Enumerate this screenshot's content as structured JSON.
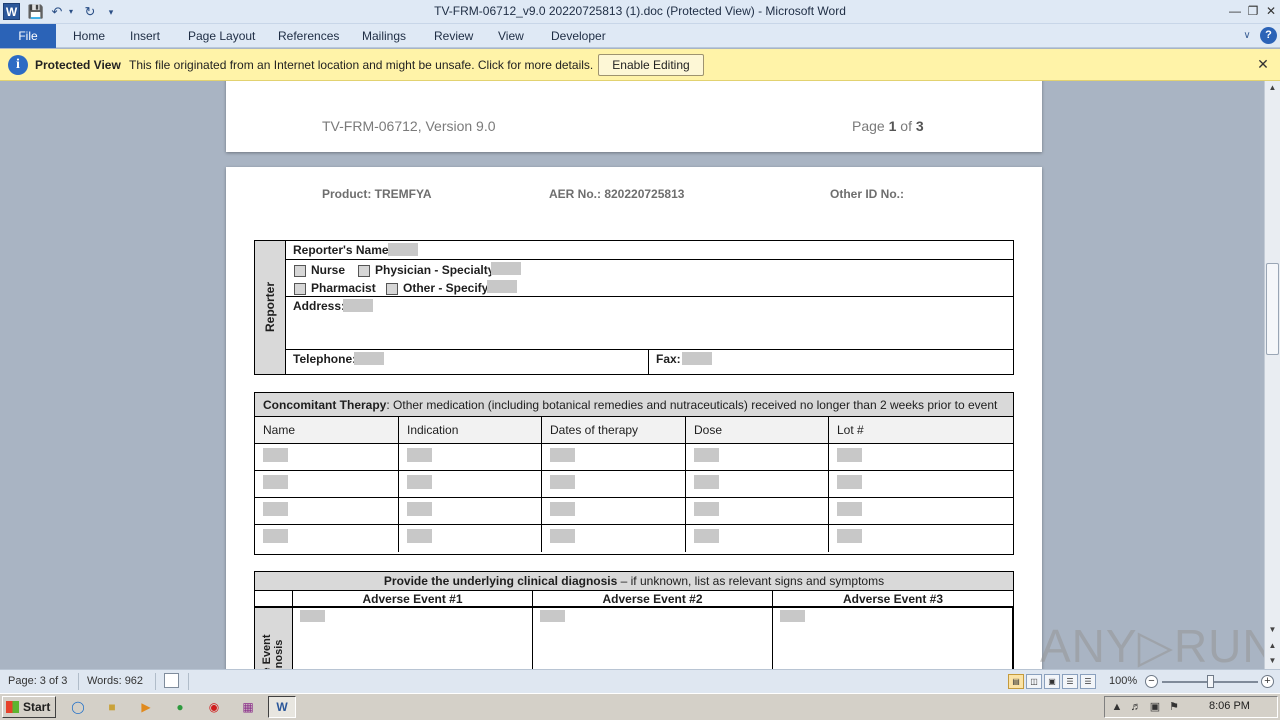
{
  "window": {
    "title": "TV-FRM-06712_v9.0 20220725813 (1).doc (Protected View)  -  Microsoft Word",
    "app_icon": "W"
  },
  "ribbon": {
    "file_tab": "File",
    "tabs": [
      "Home",
      "Insert",
      "Page Layout",
      "References",
      "Mailings",
      "Review",
      "View",
      "Developer"
    ]
  },
  "protected_view": {
    "title": "Protected View",
    "message": "This file originated from an Internet location and might be unsafe. Click for more details.",
    "button": "Enable Editing"
  },
  "page1": {
    "header_left": "TV-FRM-06712,  Version 9.0",
    "page_word": "Page ",
    "page_num": "1",
    "page_of": " of ",
    "page_total": "3"
  },
  "page2": {
    "product": "Product: TREMFYA",
    "aer": "AER No.: 820220725813",
    "other_id": "Other ID No.:",
    "reporter": {
      "side_label": "Reporter",
      "name_label": "Reporter's Name:",
      "nurse": "Nurse",
      "physician": "Physician - Specialty:",
      "pharmacist": "Pharmacist",
      "other": "Other - Specify:",
      "address": "Address:",
      "telephone": "Telephone:",
      "fax": "Fax:"
    },
    "concomitant": {
      "title": "Concomitant Therapy",
      "subtitle": ": Other medication  (including botanical  remedies and nutraceuticals)  received no longer than 2 weeks prior to event",
      "columns": [
        "Name",
        "Indication",
        "Dates  of therapy",
        "Dose",
        "Lot #"
      ]
    },
    "diagnosis": {
      "title": "Provide the underlying clinical diagnosis",
      "subtitle": " – if unknown, list  as relevant signs  and symptoms",
      "events": [
        "Adverse  Event #1",
        "Adverse  Event #2",
        "Adverse  Event #3"
      ],
      "side_label_1": "e Event",
      "side_label_2": "nosis"
    }
  },
  "watermark": "ANY▷RUN",
  "status": {
    "page": "Page: 3 of 3",
    "words": "Words: 962",
    "zoom": "100%"
  },
  "taskbar": {
    "start": "Start",
    "clock": "8:06 PM"
  },
  "colors": {
    "file_tab": "#2b63b7",
    "protected_bar": "#fff3a8",
    "doc_background": "#a9b4c3"
  }
}
